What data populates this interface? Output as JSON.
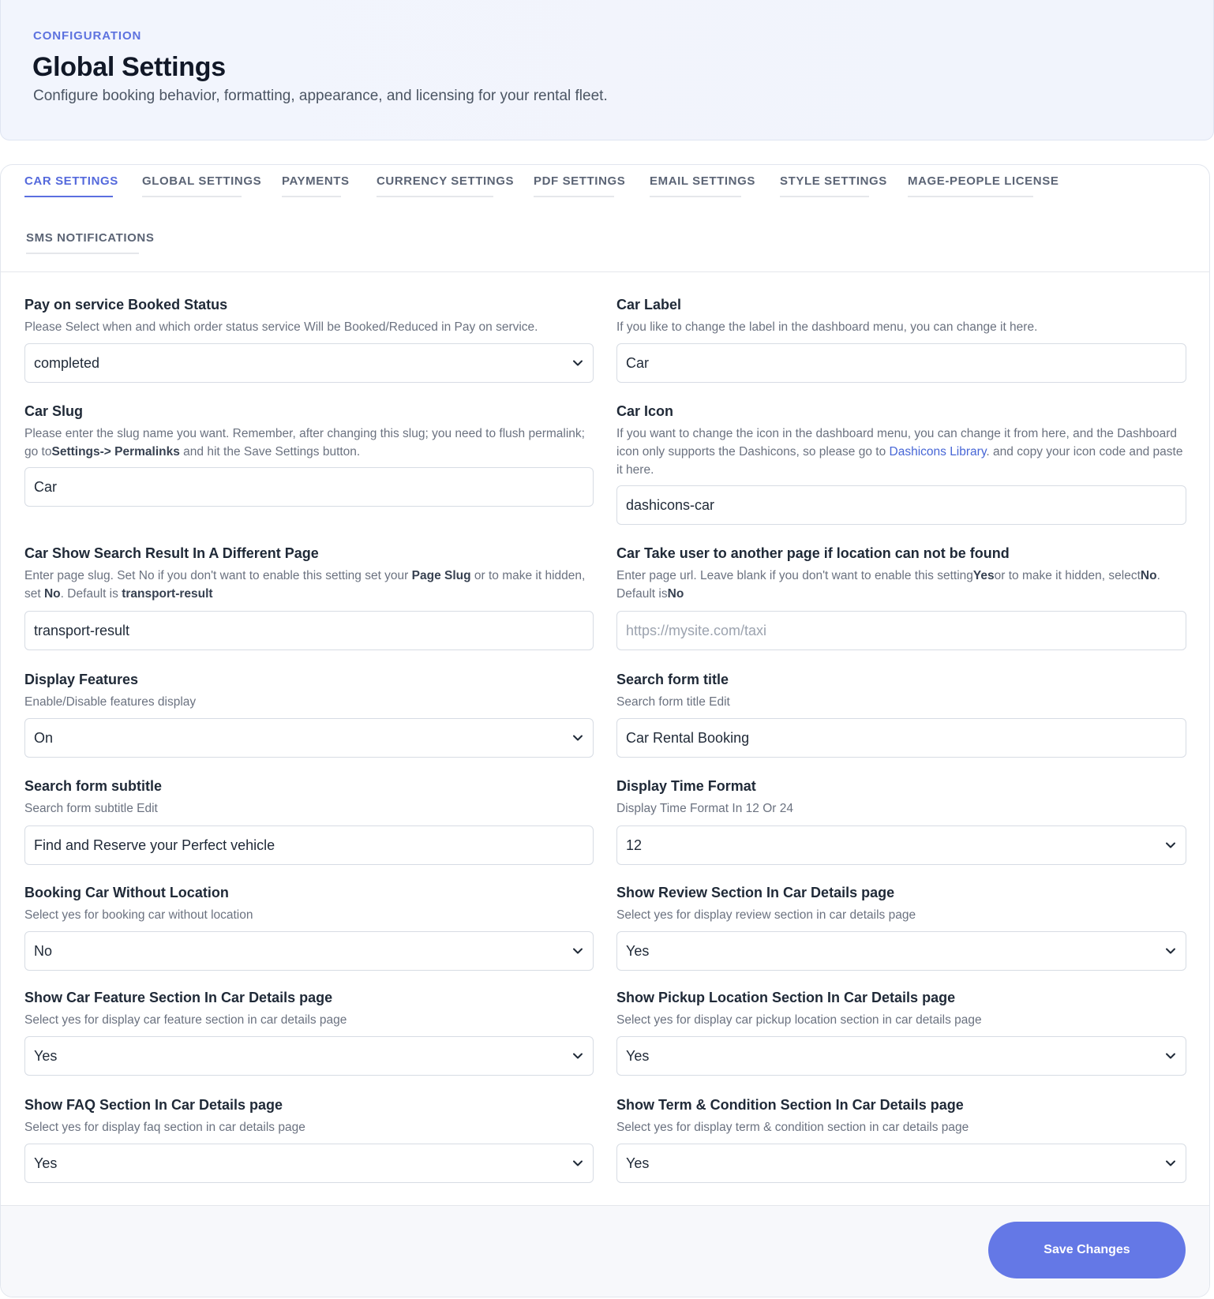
{
  "header": {
    "eyebrow": "CONFIGURATION",
    "title": "Global Settings",
    "subtitle": "Configure booking behavior, formatting, appearance, and licensing for your rental fleet."
  },
  "tabs": [
    {
      "label": "CAR SETTINGS",
      "active": true
    },
    {
      "label": "GLOBAL SETTINGS",
      "active": false
    },
    {
      "label": "PAYMENTS",
      "active": false
    },
    {
      "label": "CURRENCY SETTINGS",
      "active": false
    },
    {
      "label": "PDF SETTINGS",
      "active": false
    },
    {
      "label": "EMAIL SETTINGS",
      "active": false
    },
    {
      "label": "STYLE SETTINGS",
      "active": false
    },
    {
      "label": "MAGE-PEOPLE LICENSE",
      "active": false
    },
    {
      "label": "SMS NOTIFICATIONS",
      "active": false
    }
  ],
  "fields": {
    "pay_status": {
      "label": "Pay on service Booked Status",
      "desc": "Please Select when and which order status service Will be Booked/Reduced in Pay on service.",
      "value": "completed",
      "type": "select"
    },
    "car_label": {
      "label": "Car Label",
      "desc": "If you like to change the label in the dashboard menu, you can change it here.",
      "value": "Car",
      "type": "text"
    },
    "car_slug": {
      "label": "Car Slug",
      "desc_1": "Please enter the slug name you want. Remember, after changing this slug; you need to flush permalink;",
      "desc_2a": "go to",
      "desc_2b": "Settings-> Permalinks",
      "desc_2c": " and hit the Save Settings button.",
      "value": "Car",
      "type": "text"
    },
    "car_icon": {
      "label": "Car Icon",
      "desc_1": "If you want to change the icon in the dashboard menu, you can change it from here, and the Dashboard",
      "desc_2a": "icon only supports the Dashicons, so please go to ",
      "desc_2link": "Dashicons Library",
      "desc_2b": ". and copy your icon code and paste",
      "desc_3": "it here.",
      "value": "dashicons-car",
      "type": "text"
    },
    "search_result_page": {
      "label": "Car Show Search Result In A Different Page",
      "desc_1a": "Enter page slug. Set No if you don't want to enable this setting set your ",
      "desc_1b": "Page Slug",
      "desc_1c": " or to make it hidden,",
      "desc_2a": "set ",
      "desc_2b": "No",
      "desc_2c": ". Default is ",
      "desc_2d": "transport-result",
      "value": "transport-result",
      "type": "text"
    },
    "location_not_found": {
      "label": "Car Take user to another page if location can not be found",
      "desc_1a": "Enter page url. Leave blank if you don't want to enable this setting",
      "desc_1b": "Yes",
      "desc_1c": "or to make it hidden, select",
      "desc_1d": "No",
      "desc_1e": ".",
      "desc_2a": "Default is",
      "desc_2b": "No",
      "value": "",
      "placeholder": "https://mysite.com/taxi",
      "type": "text"
    },
    "display_features": {
      "label": "Display Features",
      "desc": "Enable/Disable features display",
      "value": "On",
      "type": "select"
    },
    "search_form_title": {
      "label": "Search form title",
      "desc": "Search form title Edit",
      "value": "Car Rental Booking",
      "type": "text"
    },
    "search_form_subtitle": {
      "label": "Search form subtitle",
      "desc": "Search form subtitle Edit",
      "value": "Find and Reserve your Perfect vehicle",
      "type": "text"
    },
    "time_format": {
      "label": "Display Time Format",
      "desc": "Display Time Format In 12 Or 24",
      "value": "12",
      "type": "select"
    },
    "booking_without_location": {
      "label": "Booking Car Without Location",
      "desc": "Select yes for booking car without location",
      "value": "No",
      "type": "select"
    },
    "show_review": {
      "label": "Show Review Section In Car Details page",
      "desc": "Select yes for display review section in car details page",
      "value": "Yes",
      "type": "select"
    },
    "show_feature": {
      "label": "Show Car Feature Section In Car Details page",
      "desc": "Select yes for display car feature section in car details page",
      "value": "Yes",
      "type": "select"
    },
    "show_pickup": {
      "label": "Show Pickup Location Section In Car Details page",
      "desc": "Select yes for display car pickup location section in car details page",
      "value": "Yes",
      "type": "select"
    },
    "show_faq": {
      "label": "Show FAQ Section In Car Details page",
      "desc": "Select yes for display faq section in car details page",
      "value": "Yes",
      "type": "select"
    },
    "show_terms": {
      "label": "Show Term & Condition Section In Car Details page",
      "desc": "Select yes for display term & condition section in car details page",
      "value": "Yes",
      "type": "select"
    }
  },
  "footer": {
    "save_label": "Save Changes"
  },
  "colors": {
    "accent": "#5b6fe0",
    "button": "#6478e6",
    "link": "#4766d6"
  },
  "icons": {
    "select_arrow": "chevron-down-icon"
  }
}
